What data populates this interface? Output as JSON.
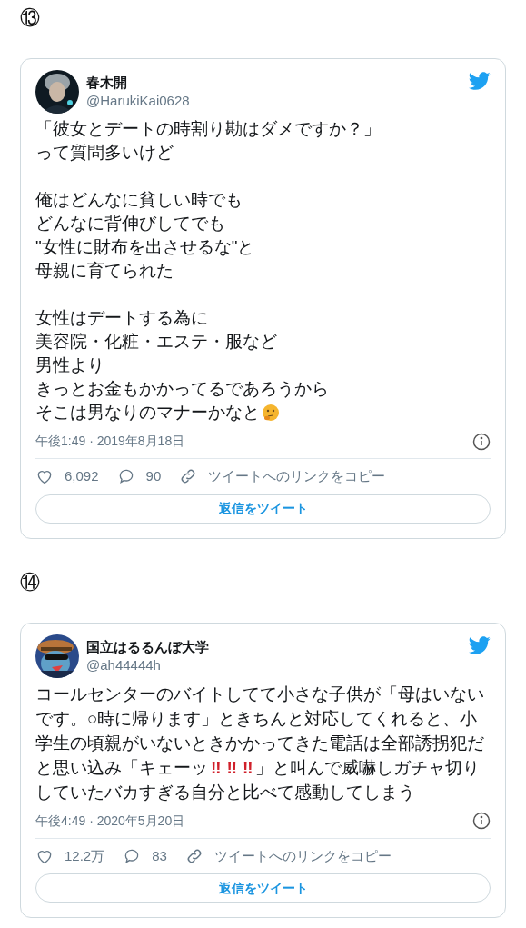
{
  "sections": [
    {
      "number": "⑬",
      "tweet": {
        "name": "春木開",
        "handle": "@HarukiKai0628",
        "body": [
          {
            "kind": "lines",
            "lines": [
              "「彼女とデートの時割り勘はダメですか？」",
              "って質問多いけど"
            ],
            "emoji": false
          },
          {
            "kind": "lines",
            "lines": [
              "俺はどんなに貧しい時でも",
              "どんなに背伸びしてでも",
              "\"女性に財布を出させるな\"と",
              "母親に育てられた"
            ],
            "emoji": false
          },
          {
            "kind": "lines",
            "lines": [
              "女性はデートする為に",
              "美容院・化粧・エステ・服など",
              "男性より",
              "きっとお金もかかってるであろうから",
              "そこは男なりのマナーかなと"
            ],
            "emoji": true
          }
        ],
        "timestamp": "午後1:49 · 2019年8月18日",
        "likes": "6,092",
        "replies": "90",
        "copy_link": "ツイートへのリンクをコピー",
        "reply_button": "返信をツイート"
      }
    },
    {
      "number": "⑭",
      "tweet": {
        "name": "国立はるるんぼ大学",
        "handle": "@ah44444h",
        "body": [
          {
            "kind": "run",
            "segments": [
              {
                "kind": "text",
                "text": "コールセンターのバイトしてて小さな子供が「母はいないです。○時に帰ります」ときちんと対応してくれると、小学生の頃親がいないときかかってきた電話は全部誘拐犯だと思い込み「キェーッ"
              },
              {
                "kind": "emphasis",
                "text": "‼︎"
              },
              {
                "kind": "emphasis",
                "text": "‼︎"
              },
              {
                "kind": "emphasis",
                "text": "‼︎"
              },
              {
                "kind": "text",
                "text": "」と叫んで威嚇しガチャ切りしていたバカすぎる自分と比べて感動してしまう"
              }
            ]
          }
        ],
        "timestamp": "午後4:49 · 2020年5月20日",
        "likes": "12.2万",
        "replies": "83",
        "copy_link": "ツイートへのリンクをコピー",
        "reply_button": "返信をツイート"
      }
    }
  ]
}
